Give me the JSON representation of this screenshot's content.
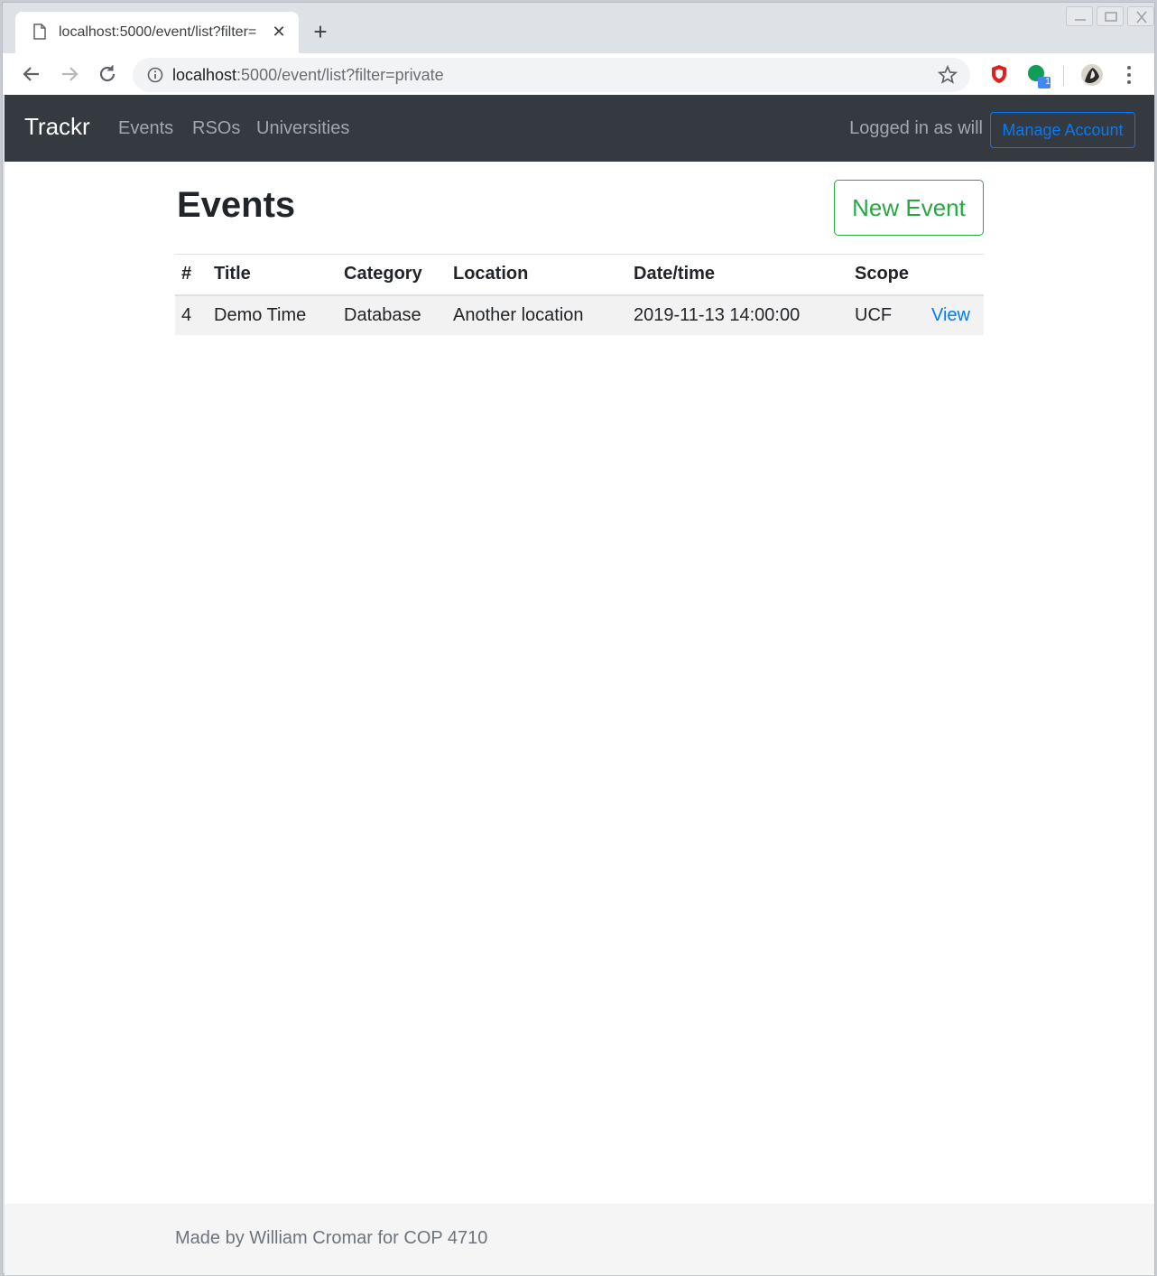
{
  "browser": {
    "tab_title": "localhost:5000/event/list?filter=",
    "url_host": "localhost",
    "url_rest": ":5000/event/list?filter=private",
    "extension_badge": "1"
  },
  "navbar": {
    "brand": "Trackr",
    "links": [
      "Events",
      "RSOs",
      "Universities"
    ],
    "logged_in_text": "Logged in as will",
    "manage_account_label": "Manage Account"
  },
  "page": {
    "title": "Events",
    "new_event_label": "New Event"
  },
  "table": {
    "headers": [
      "#",
      "Title",
      "Category",
      "Location",
      "Date/time",
      "Scope",
      ""
    ],
    "rows": [
      {
        "id": "4",
        "title": "Demo Time",
        "category": "Database",
        "location": "Another location",
        "datetime": "2019-11-13 14:00:00",
        "scope": "UCF",
        "action": "View"
      }
    ]
  },
  "footer": {
    "text": "Made by William Cromar for COP 4710"
  },
  "colors": {
    "navbar_bg": "#343a40",
    "primary": "#007bff",
    "success": "#28a745"
  }
}
